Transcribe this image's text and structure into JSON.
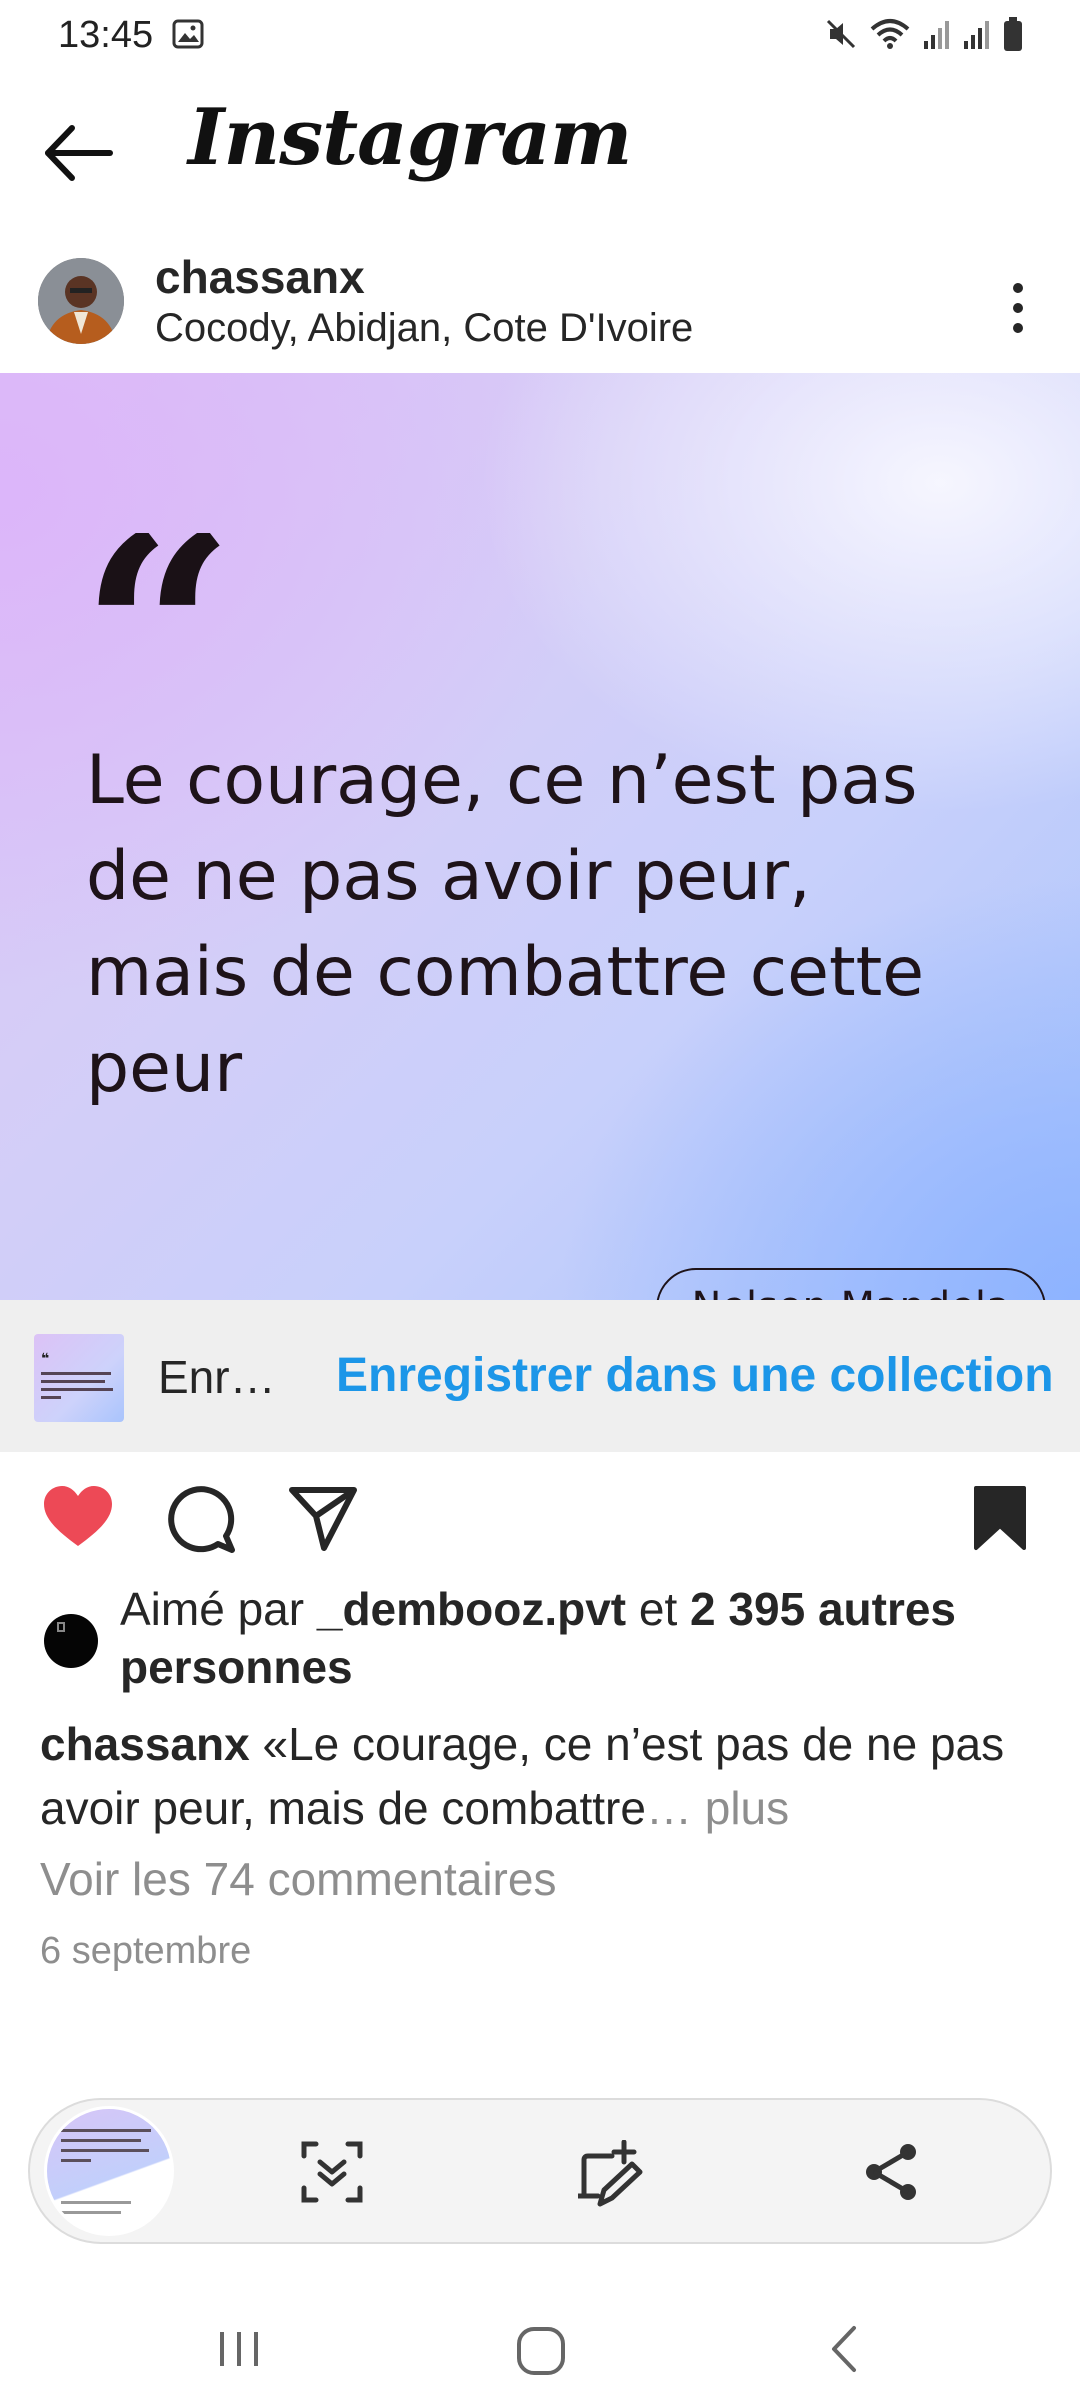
{
  "status_bar": {
    "time": "13:45",
    "icons": [
      "gallery-icon",
      "mute-icon",
      "wifi-icon",
      "signal-icon",
      "signal-icon",
      "battery-icon"
    ]
  },
  "header": {
    "app_name": "Instagram"
  },
  "post": {
    "author": "chassanx",
    "location": "Cocody, Abidjan, Cote D'Ivoire",
    "image": {
      "quote_mark": "“",
      "quote_text": "Le courage, ce n’est pas de ne pas avoir peur, mais de combattre cette peur",
      "author_tag": "Nelson Mandela"
    },
    "save_bar": {
      "label": "Enr…",
      "link": "Enregistrer dans une collection"
    },
    "likes": {
      "prefix": "Aimé par ",
      "user": "_dembooz.pvt",
      "middle": " et ",
      "count": "2 395 autres personnes"
    },
    "caption": {
      "user": "chassanx",
      "text": " «Le courage, ce n’est pas de ne pas avoir peur, mais de combattre",
      "more": "… plus"
    },
    "comments_link": "Voir les 74 commentaires",
    "date": "6 septembre"
  },
  "colors": {
    "like": "#ed4956",
    "link": "#1c96e8",
    "muted": "#8e8e8e"
  }
}
